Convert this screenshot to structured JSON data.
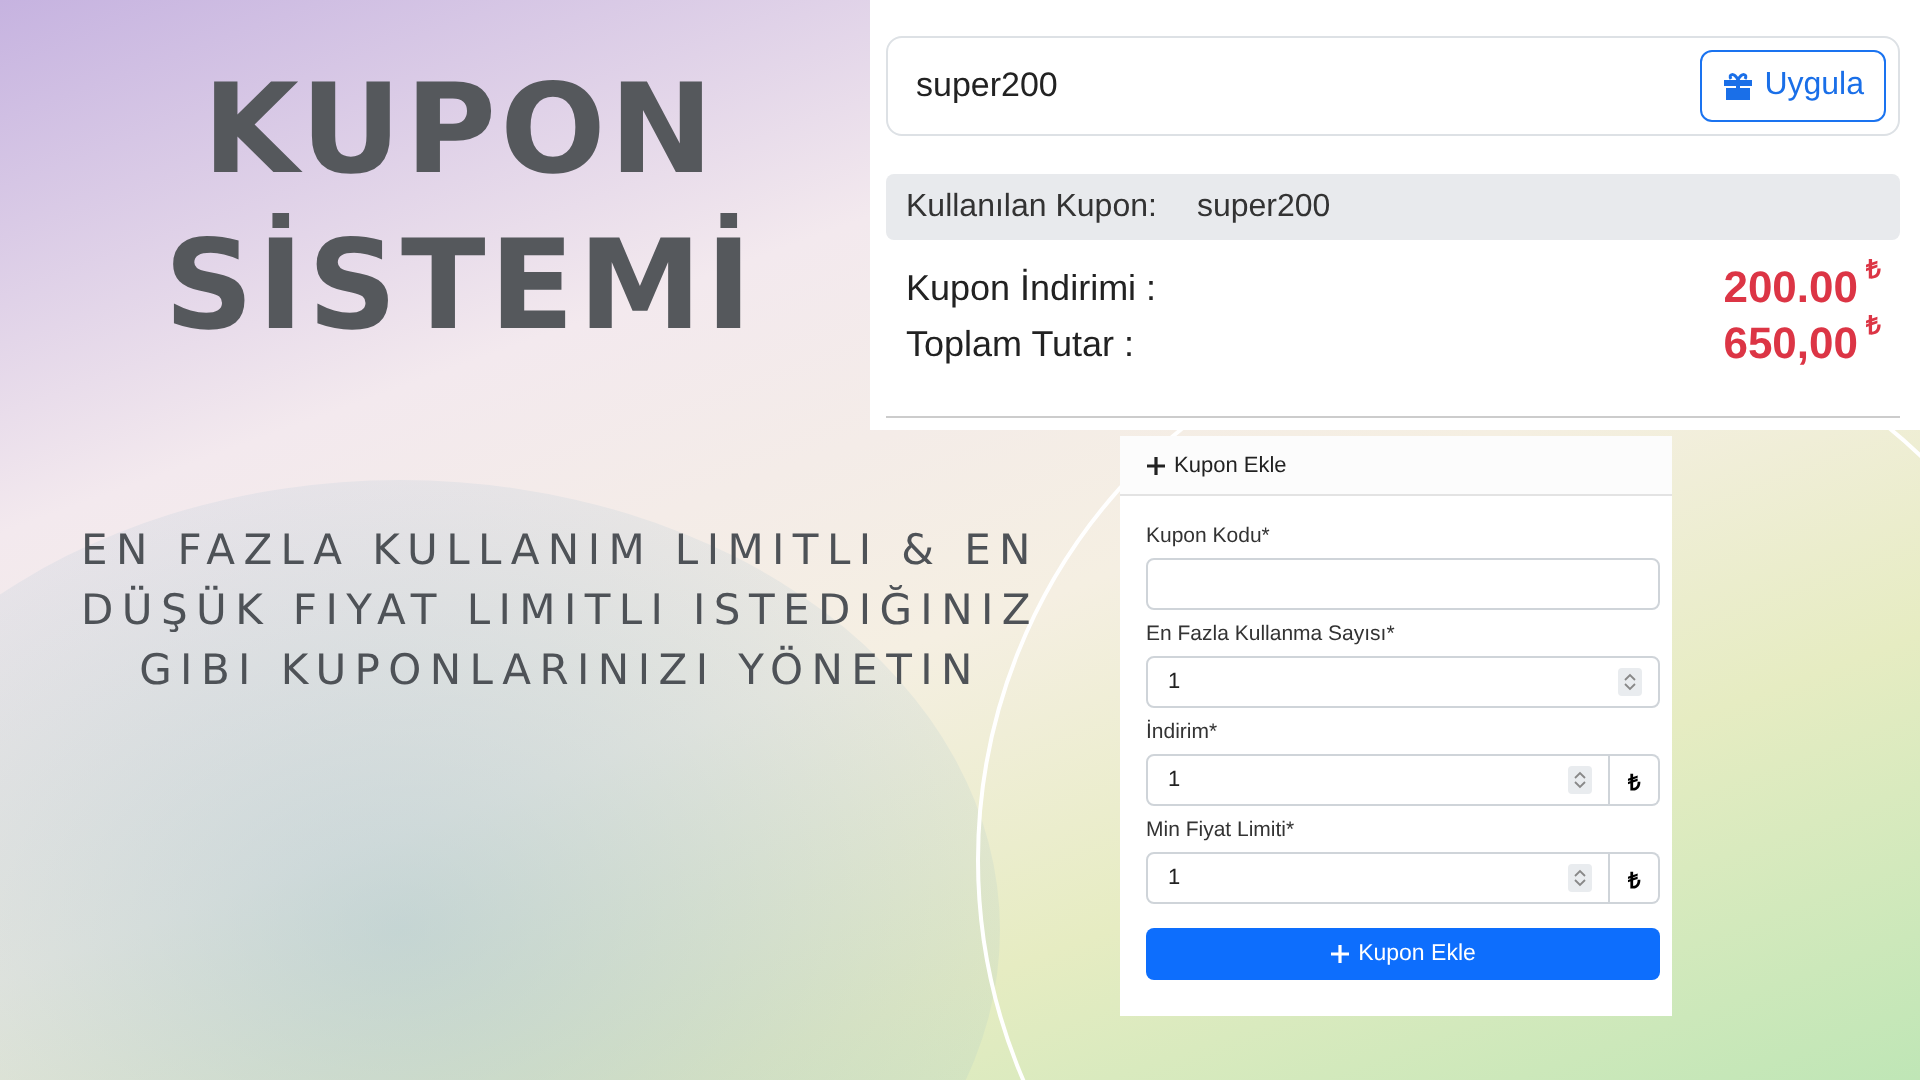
{
  "headline": {
    "title_lines": [
      "KUPON",
      "SİSTEMİ"
    ],
    "subtitle": "EN FAZLA KULLANIM LIMITLI & EN DÜŞÜK FIYAT LIMITLI ISTEDIĞINIZ GIBI KUPONLARINIZI YÖNETIN"
  },
  "coupon_panel": {
    "coupon_input": {
      "value": "super200"
    },
    "apply_button": {
      "label": "Uygula"
    },
    "applied_coupon": {
      "label": "Kullanılan Kupon:",
      "code": "super200"
    },
    "totals": [
      {
        "label": "Kupon İndirimi :",
        "amount": "200.00",
        "currency": "₺"
      },
      {
        "label": "Toplam Tutar :",
        "amount": "650,00",
        "currency": "₺"
      }
    ]
  },
  "coupon_form": {
    "header": "Kupon Ekle",
    "fields": [
      {
        "kind": "text",
        "label": "Kupon Kodu*"
      },
      {
        "kind": "number",
        "label": "En Fazla Kullanma Sayısı*",
        "value": "1"
      },
      {
        "kind": "currency",
        "label": "İndirim*",
        "value": "1",
        "suffix": "₺"
      },
      {
        "kind": "currency",
        "label": "Min Fiyat Limiti*",
        "value": "1",
        "suffix": "₺"
      }
    ],
    "submit_button": {
      "label": "Kupon Ekle"
    }
  }
}
